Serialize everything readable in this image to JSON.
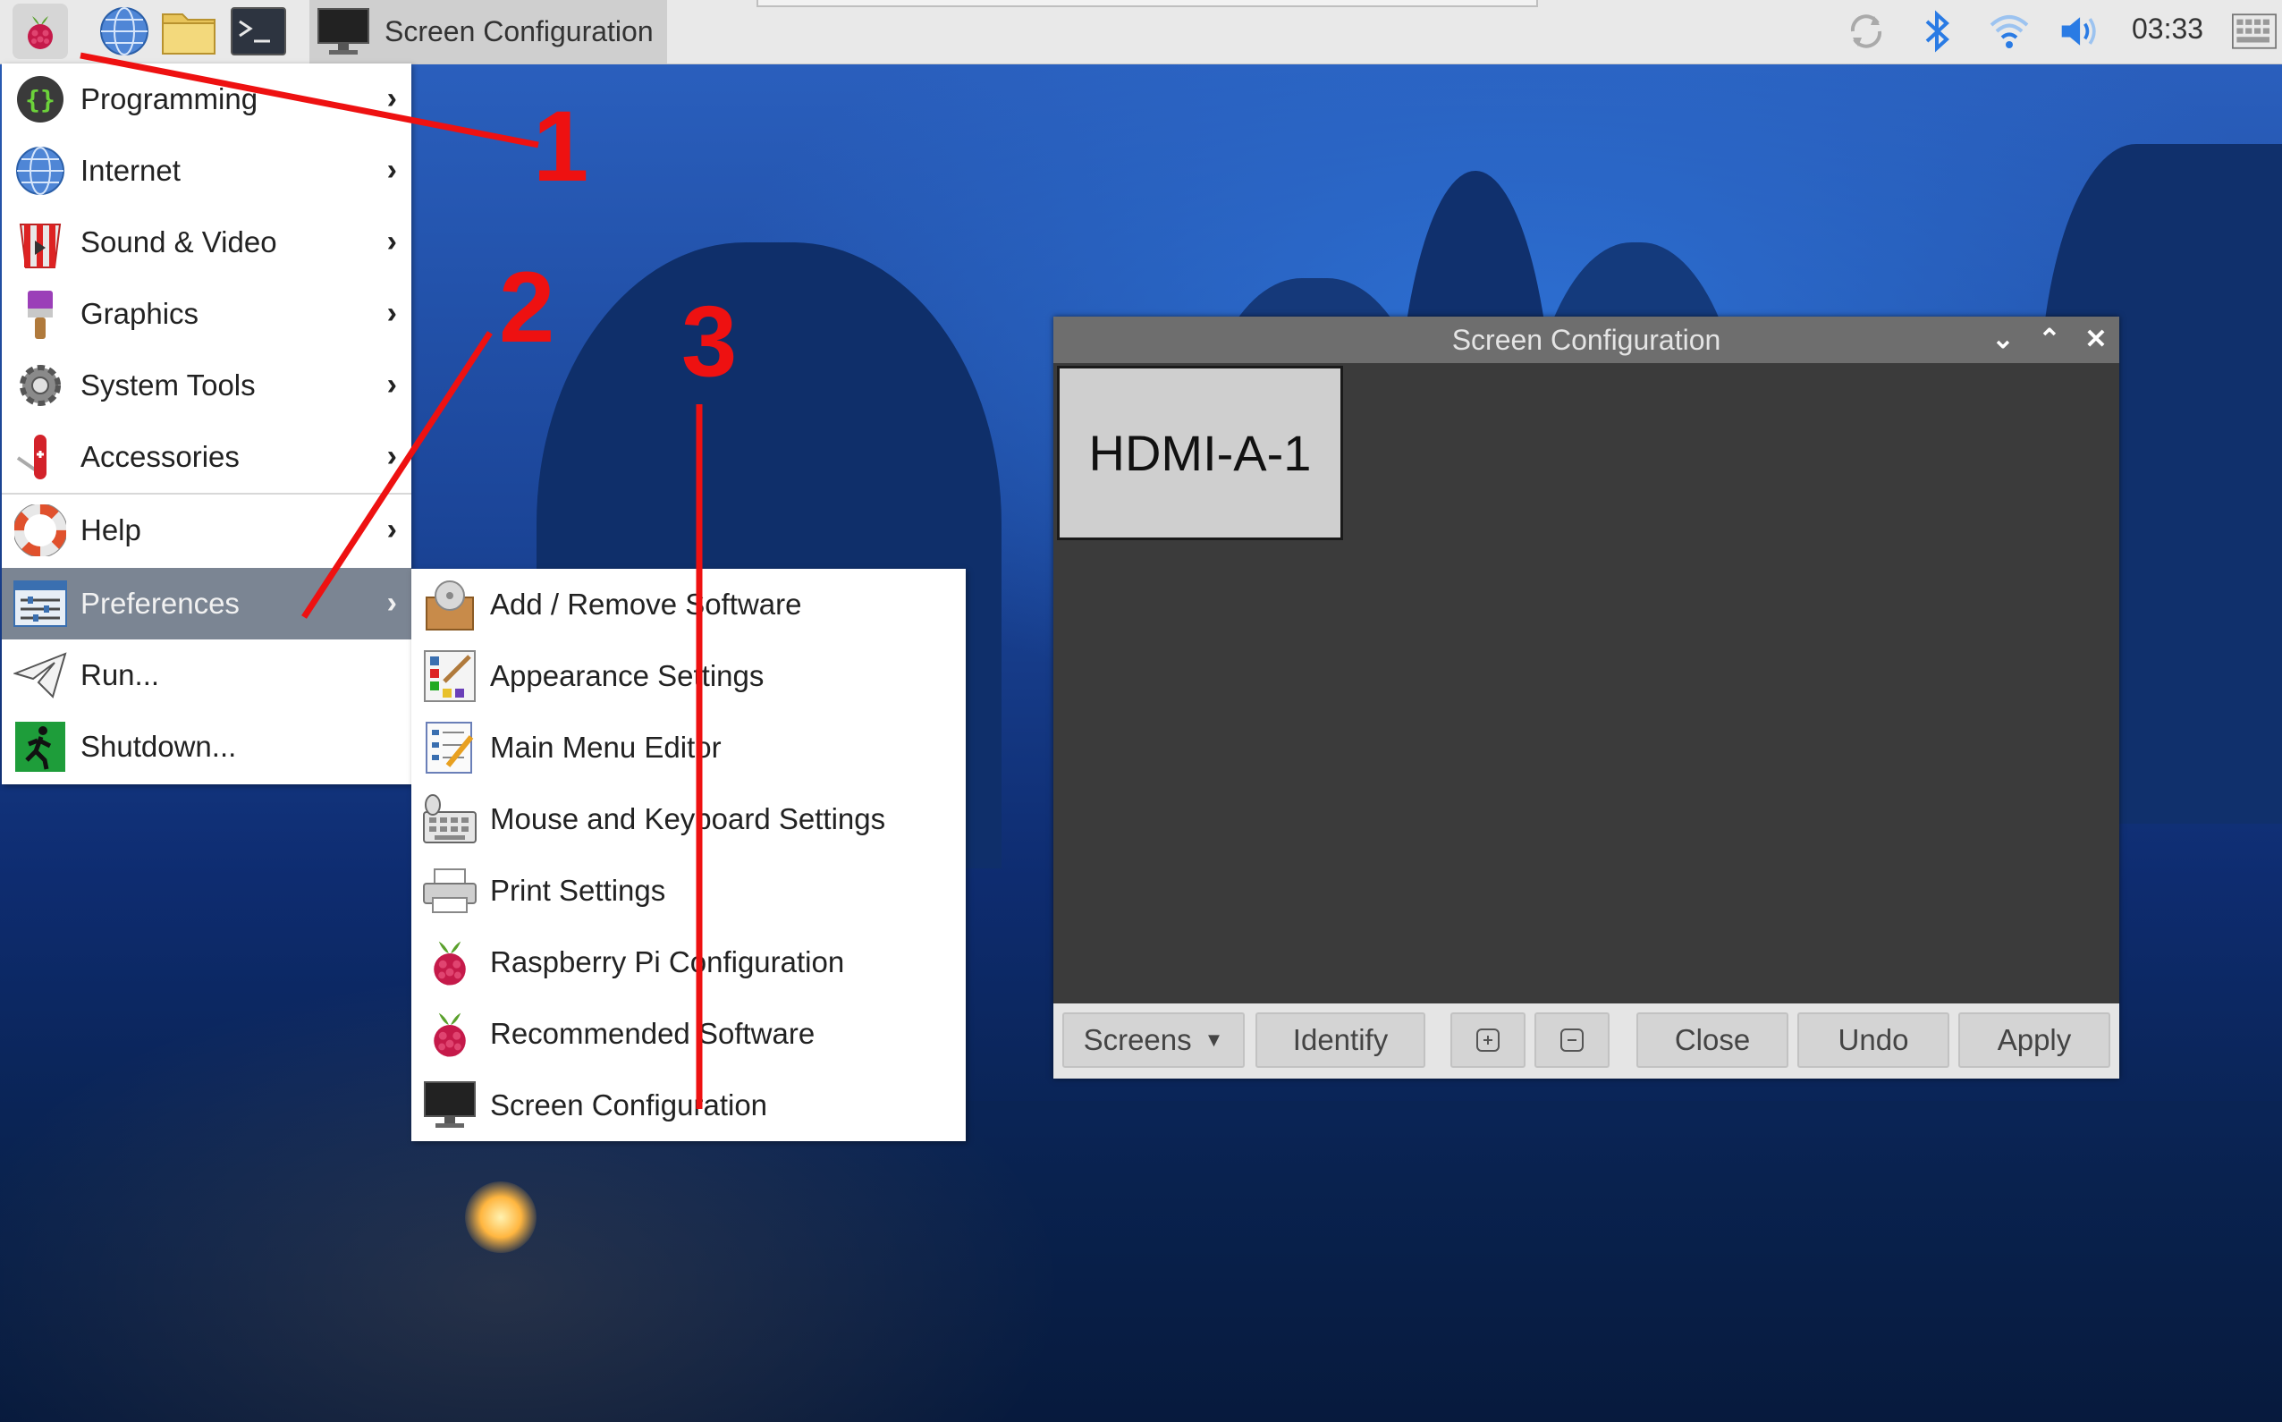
{
  "taskbar": {
    "task_button_label": "Screen Configuration",
    "clock": "03:33",
    "launchers": [
      "raspberry-menu-icon",
      "web-browser-icon",
      "file-manager-icon",
      "terminal-icon"
    ]
  },
  "main_menu": {
    "items": [
      {
        "label": "Programming",
        "icon": "programming-icon"
      },
      {
        "label": "Internet",
        "icon": "internet-icon"
      },
      {
        "label": "Sound & Video",
        "icon": "sound-video-icon"
      },
      {
        "label": "Graphics",
        "icon": "graphics-icon"
      },
      {
        "label": "System Tools",
        "icon": "system-tools-icon"
      },
      {
        "label": "Accessories",
        "icon": "accessories-icon"
      },
      {
        "label": "Help",
        "icon": "help-icon"
      },
      {
        "label": "Preferences",
        "icon": "preferences-icon",
        "active": true
      },
      {
        "label": "Run...",
        "icon": "run-icon"
      },
      {
        "label": "Shutdown...",
        "icon": "shutdown-icon"
      }
    ]
  },
  "preferences_submenu": {
    "items": [
      {
        "label": "Add / Remove Software",
        "icon": "add-remove-software-icon"
      },
      {
        "label": "Appearance Settings",
        "icon": "appearance-settings-icon"
      },
      {
        "label": "Main Menu Editor",
        "icon": "main-menu-editor-icon"
      },
      {
        "label": "Mouse and Keyboard Settings",
        "icon": "mouse-keyboard-icon"
      },
      {
        "label": "Print Settings",
        "icon": "printer-icon"
      },
      {
        "label": "Raspberry Pi Configuration",
        "icon": "raspberry-icon"
      },
      {
        "label": "Recommended Software",
        "icon": "raspberry-icon"
      },
      {
        "label": "Screen Configuration",
        "icon": "monitor-icon"
      }
    ]
  },
  "dialog": {
    "title": "Screen Configuration",
    "monitor": "HDMI-A-1",
    "buttons": {
      "screens": "Screens",
      "identify": "Identify",
      "close": "Close",
      "undo": "Undo",
      "apply": "Apply"
    }
  },
  "annotations": {
    "numbers": [
      "1",
      "2",
      "3"
    ],
    "color": "#ee1111"
  },
  "colors": {
    "taskbar_bg": "#e9e9e9",
    "menu_active_bg": "#7b8593",
    "dialog_title_bg": "#6e6e6e",
    "dialog_body_bg": "#3b3b3b"
  }
}
